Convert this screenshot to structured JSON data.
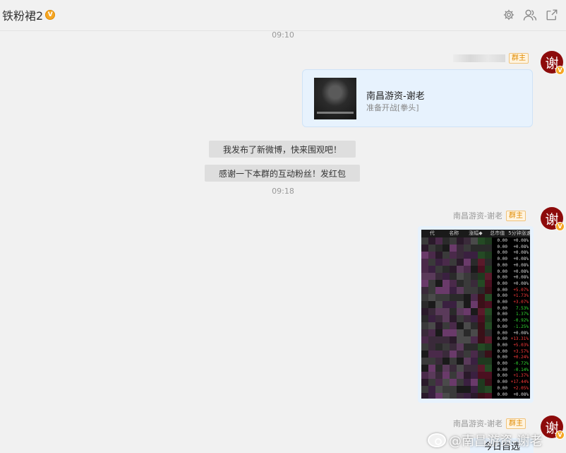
{
  "header": {
    "title": "铁粉裙2",
    "verified_mark": "V",
    "icons": [
      "gear-icon",
      "group-members-icon",
      "open-external-icon"
    ]
  },
  "messages": {
    "time1": "09:10",
    "share_card": {
      "sender_role": "群主",
      "title": "南昌游资-谢老",
      "subtitle": "准备开战[拳头]"
    },
    "sys1": "我发布了新微博，快来围观吧！",
    "sys2": "感谢一下本群的互动粉丝！发红包",
    "time2": "09:18",
    "image_msg": {
      "sender_name": "南昌游资-谢老",
      "sender_role": "群主",
      "stock_headers": [
        "代",
        "名称",
        "涨幅◆",
        "总市值",
        "5分钟涨速"
      ],
      "rows": [
        [
          "0.00",
          "+0.08%",
          "#d8d8d8"
        ],
        [
          "0.00",
          "+0.08%",
          "#d8d8d8"
        ],
        [
          "0.00",
          "+0.08%",
          "#d8d8d8"
        ],
        [
          "0.00",
          "+0.08%",
          "#d8d8d8"
        ],
        [
          "0.00",
          "+0.08%",
          "#d8d8d8"
        ],
        [
          "0.00",
          "+0.08%",
          "#d8d8d8"
        ],
        [
          "0.00",
          "+0.08%",
          "#d8d8d8"
        ],
        [
          "0.00",
          "+0.08%",
          "#d8d8d8"
        ],
        [
          "0.00",
          "+5.07%",
          "#ff3b3b"
        ],
        [
          "0.00",
          "+1.73%",
          "#ff3b3b"
        ],
        [
          "0.00",
          "+3.07%",
          "#ff3b3b"
        ],
        [
          "0.00",
          "7.53%",
          "#33dd33"
        ],
        [
          "0.00",
          "1.37%",
          "#33dd33"
        ],
        [
          "0.00",
          "-0.92%",
          "#33dd33"
        ],
        [
          "0.00",
          "-1.25%",
          "#33dd33"
        ],
        [
          "0.00",
          "+0.08%",
          "#d8d8d8"
        ],
        [
          "0.00",
          "+13.31%",
          "#ff3b3b"
        ],
        [
          "0.00",
          "+5.03%",
          "#ff3b3b"
        ],
        [
          "0.00",
          "+3.57%",
          "#ff3b3b"
        ],
        [
          "0.00",
          "+0.24%",
          "#ff3b3b"
        ],
        [
          "0.00",
          "-0.72%",
          "#33dd33"
        ],
        [
          "0.00",
          "-0.14%",
          "#33dd33"
        ],
        [
          "0.00",
          "+1.37%",
          "#ff3b3b"
        ],
        [
          "0.00",
          "+17.44%",
          "#ff3b3b"
        ],
        [
          "0.00",
          "+2.05%",
          "#ff3b3b"
        ],
        [
          "0.00",
          "+0.08%",
          "#d8d8d8"
        ]
      ]
    },
    "last_msg": {
      "sender_name": "南昌游资-谢老",
      "sender_role": "群主",
      "text": "今日自选"
    }
  },
  "avatar": {
    "glyph": "谢",
    "badge": "V",
    "color": "#8d0b0b"
  },
  "watermark": "@南昌游资-谢老"
}
